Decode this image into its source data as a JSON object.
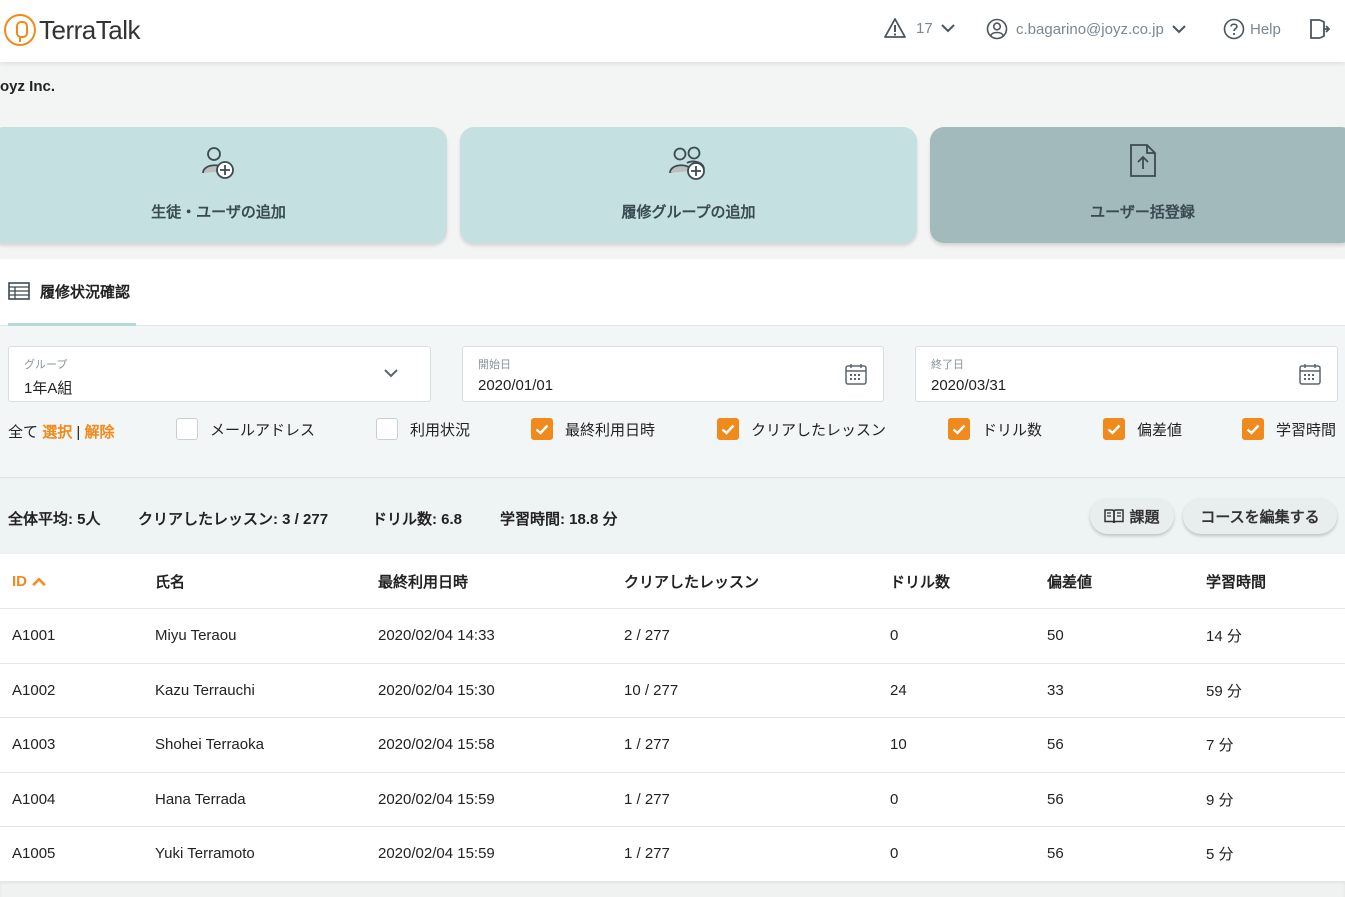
{
  "app": {
    "logo_text": "TerraTalk",
    "brand_color": "#f08a1c",
    "accent_teal": "#c4e0e0"
  },
  "header": {
    "alerts_count": "17",
    "user_email": "c.bagarino@joyz.co.jp",
    "help_label": "Help"
  },
  "company_name": "oyz Inc.",
  "actions": [
    {
      "label": "生徒・ユーザの追加",
      "icon": "add-user-icon"
    },
    {
      "label": "履修グループの追加",
      "icon": "add-group-icon"
    },
    {
      "label": "ユーザー括登録",
      "icon": "file-upload-icon"
    }
  ],
  "tab": {
    "label": "履修状況確認",
    "icon": "table-icon"
  },
  "filters": {
    "group": {
      "label": "グループ",
      "value": "1年A組"
    },
    "start": {
      "label": "開始日",
      "value": "2020/01/01"
    },
    "end": {
      "label": "終了日",
      "value": "2020/03/31"
    },
    "all_label": "全て",
    "select_label": "選択",
    "separator": "|",
    "clear_label": "解除",
    "columns": [
      {
        "label": "メールアドレス",
        "checked": false
      },
      {
        "label": "利用状況",
        "checked": false
      },
      {
        "label": "最終利用日時",
        "checked": true
      },
      {
        "label": "クリアしたレッスン",
        "checked": true
      },
      {
        "label": "ドリル数",
        "checked": true
      },
      {
        "label": "偏差値",
        "checked": true
      },
      {
        "label": "学習時間",
        "checked": true
      }
    ]
  },
  "summary": {
    "avg_label": "全体平均:",
    "avg_value": "5人",
    "lessons_label": "クリアしたレッスン:",
    "lessons_value": "3 / 277",
    "drills_label": "ドリル数:",
    "drills_value": "6.8",
    "time_label": "学習時間:",
    "time_value": "18.8 分",
    "assignments_button": "課題",
    "edit_course_button": "コースを編集する"
  },
  "table": {
    "headers": [
      "ID",
      "氏名",
      "最終利用日時",
      "クリアしたレッスン",
      "ドリル数",
      "偏差値",
      "学習時間"
    ],
    "rows": [
      [
        "A1001",
        "Miyu Teraou",
        "2020/02/04 14:33",
        "2 / 277",
        "0",
        "50",
        "14 分"
      ],
      [
        "A1002",
        "Kazu Terrauchi",
        "2020/02/04 15:30",
        "10 / 277",
        "24",
        "33",
        "59 分"
      ],
      [
        "A1003",
        "Shohei Terraoka",
        "2020/02/04 15:58",
        "1 / 277",
        "10",
        "56",
        "7 分"
      ],
      [
        "A1004",
        "Hana Terrada",
        "2020/02/04 15:59",
        "1 / 277",
        "0",
        "56",
        "9 分"
      ],
      [
        "A1005",
        "Yuki Terramoto",
        "2020/02/04 15:59",
        "1 / 277",
        "0",
        "56",
        "5 分"
      ]
    ]
  }
}
